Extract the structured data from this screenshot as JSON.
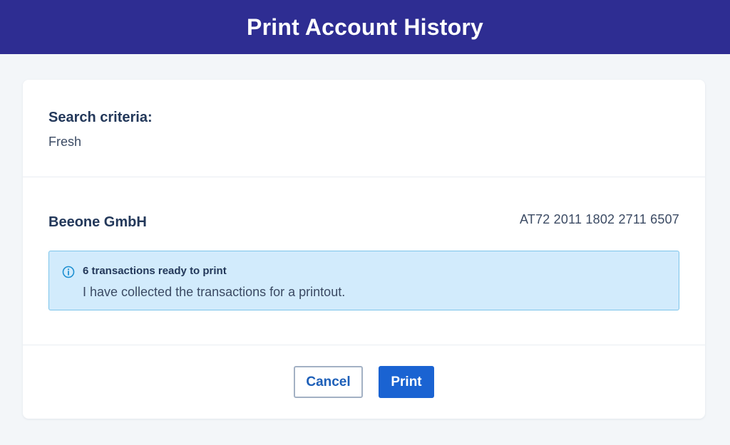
{
  "header": {
    "title": "Print Account History"
  },
  "criteria": {
    "title": "Search criteria:",
    "value": "Fresh"
  },
  "account": {
    "name": "Beeone GmbH",
    "iban": "AT72 2011 1802 2711 6507"
  },
  "info": {
    "icon": "info-icon",
    "title": "6 transactions ready to print",
    "text": "I have collected the transactions for a printout."
  },
  "actions": {
    "cancel_label": "Cancel",
    "print_label": "Print"
  },
  "colors": {
    "header_bg": "#2e2d92",
    "info_bg": "#d2ebfc",
    "info_border": "#7cc4ea",
    "primary": "#1a63d2"
  }
}
